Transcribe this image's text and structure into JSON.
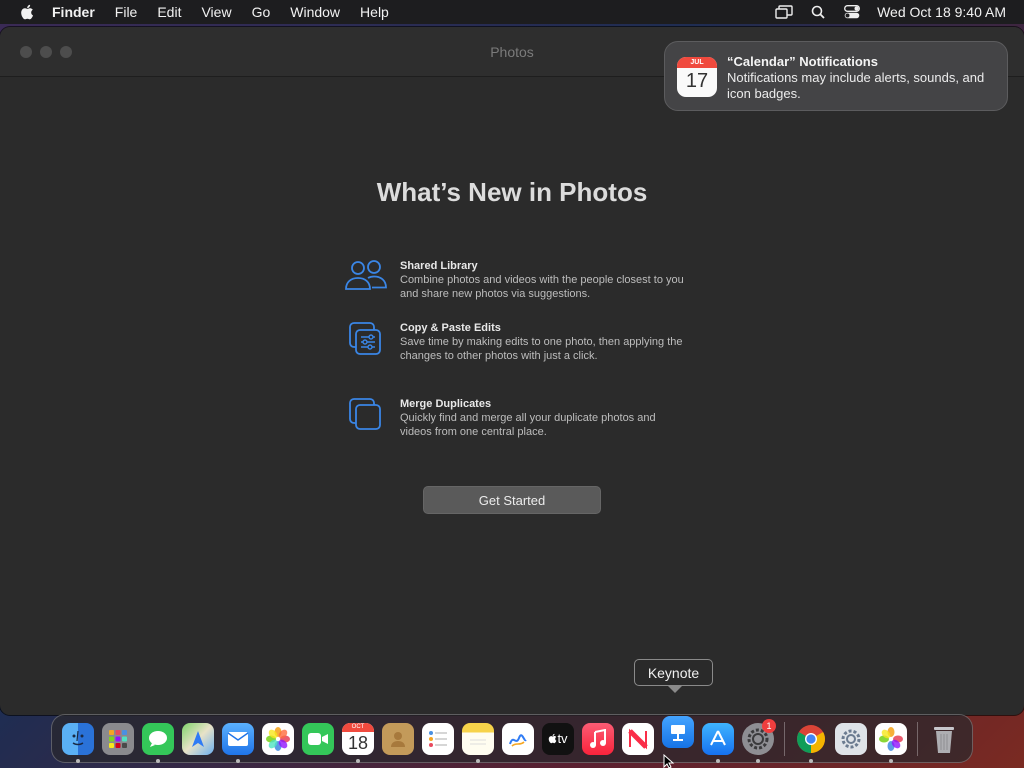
{
  "menubar": {
    "app_name": "Finder",
    "menus": [
      "File",
      "Edit",
      "View",
      "Go",
      "Window",
      "Help"
    ],
    "clock": "Wed Oct 18  9:40 AM"
  },
  "window": {
    "title": "Photos",
    "headline": "What’s New in Photos",
    "features": [
      {
        "icon": "people-icon",
        "title": "Shared Library",
        "description": "Combine photos and videos with the people closest to you and share new photos via suggestions."
      },
      {
        "icon": "copy-edits-icon",
        "title": "Copy & Paste Edits",
        "description": "Save time by making edits to one photo, then applying the changes to other photos with just a click."
      },
      {
        "icon": "duplicates-icon",
        "title": "Merge Duplicates",
        "description": "Quickly find and merge all your duplicate photos and videos from one central place."
      }
    ],
    "button": "Get Started"
  },
  "notification": {
    "icon_month": "JUL",
    "icon_day": "17",
    "title": "“Calendar” Notifications",
    "body": "Notifications may include alerts, sounds, and icon badges."
  },
  "tooltip": "Keynote",
  "dock": {
    "calendar_month": "OCT",
    "calendar_day": "18",
    "tv_label": "tv",
    "settings_badge": "1"
  },
  "colors": {
    "accent_blue": "#3a86e6",
    "window_bg": "#2b2b2b",
    "button_bg": "#5a5a5a"
  }
}
